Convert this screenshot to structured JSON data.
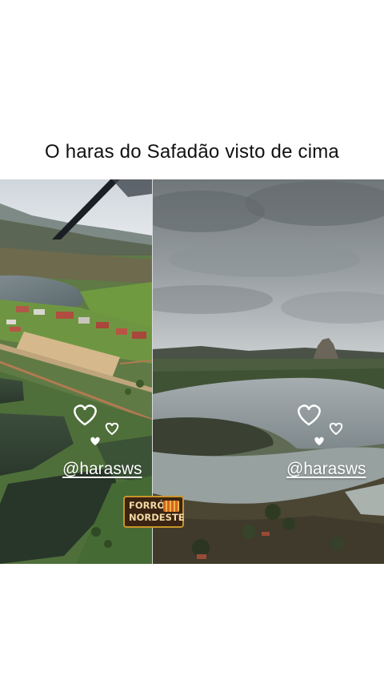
{
  "post": {
    "title": "O haras do Safadão visto de cima"
  },
  "collage": {
    "left_panel": {
      "watermark": "@harasws"
    },
    "right_panel": {
      "watermark": "@harasws"
    },
    "logo": {
      "line1": "FORRÓ",
      "line2": "NORDESTE"
    }
  },
  "icons": {
    "hearts": "heart-icon",
    "logo_accordion": "accordion-icon"
  },
  "colors": {
    "background": "#ffffff",
    "title_text": "#111111",
    "watermark_text": "#ffffff",
    "logo_background": "#3a2413",
    "logo_text": "#f3d9a3"
  }
}
